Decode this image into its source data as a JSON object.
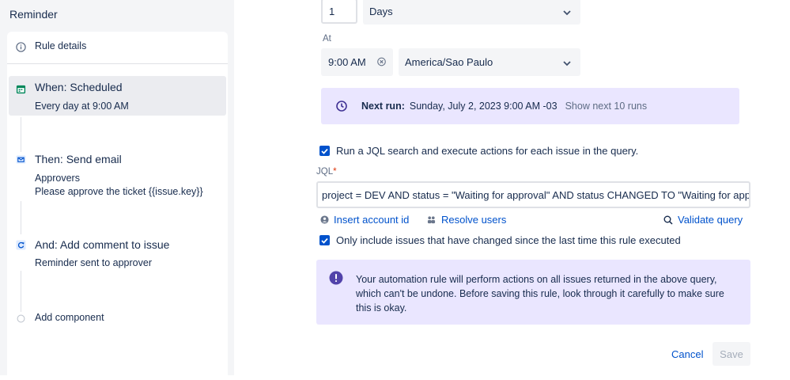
{
  "sidebar": {
    "title": "Reminder",
    "rule_details": "Rule details",
    "when": {
      "title": "When: Scheduled",
      "subtitle": "Every day at 9:00 AM"
    },
    "then": {
      "title": "Then: Send email",
      "line1": "Approvers",
      "line2": "Please approve the ticket {{issue.key}}"
    },
    "and": {
      "title": "And: Add comment to issue",
      "subtitle": "Reminder sent to approver"
    },
    "add_component": "Add component"
  },
  "schedule": {
    "interval_value": "1",
    "interval_unit": "Days",
    "at_label": "At",
    "time_value": "9:00 AM",
    "timezone": "America/Sao Paulo",
    "next_run_label": "Next run:",
    "next_run_value": "Sunday, July 2, 2023 9:00 AM -03",
    "show_next_runs": "Show next 10 runs"
  },
  "jql": {
    "run_search_label": "Run a JQL search and execute actions for each issue in the query.",
    "label": "JQL",
    "required_mark": "*",
    "value": "project = DEV AND status = \"Waiting for approval\" AND status CHANGED TO \"Waiting for approval\"",
    "insert_account_id": "Insert account id",
    "resolve_users": "Resolve users",
    "validate_query": "Validate query",
    "only_changed_label": "Only include issues that have changed since the last time this rule executed",
    "warning": "Your automation rule will perform actions on all issues returned in the above query, which can't be undone. Before saving this rule, look through it carefully to make sure this is okay."
  },
  "actions": {
    "cancel": "Cancel",
    "save": "Save"
  },
  "colors": {
    "accent": "#0052cc",
    "panel": "#f4f5f7",
    "info_bg": "#eae6ff",
    "warning_icon": "#5243aa",
    "calendar_icon": "#00875a"
  }
}
